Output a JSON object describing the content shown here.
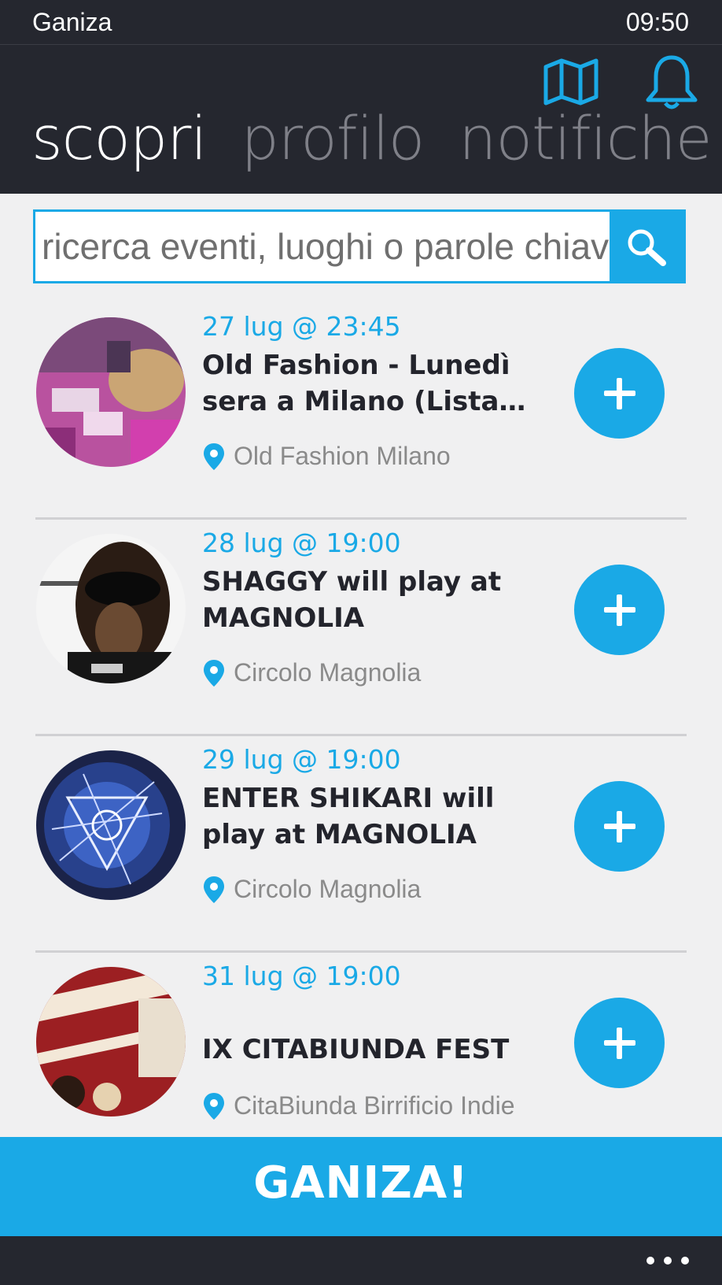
{
  "status_bar": {
    "app_name": "Ganiza",
    "time": "09:50"
  },
  "header": {
    "icons": [
      "map-icon",
      "bell-icon"
    ],
    "tabs": [
      {
        "label": "scopri",
        "active": true
      },
      {
        "label": "profilo",
        "active": false
      },
      {
        "label": "notifiche",
        "active": false
      }
    ]
  },
  "search": {
    "placeholder": "ricerca eventi, luoghi o parole chiave",
    "value": ""
  },
  "events": [
    {
      "date": "27 lug @ 23:45",
      "title": "Old Fashion - Lunedì sera a Milano (Lista…",
      "venue": "Old Fashion Milano"
    },
    {
      "date": "28 lug @ 19:00",
      "title": "SHAGGY will play at MAGNOLIA",
      "venue": "Circolo Magnolia"
    },
    {
      "date": "29 lug @ 19:00",
      "title": "ENTER SHIKARI will play at MAGNOLIA",
      "venue": "Circolo Magnolia"
    },
    {
      "date": "31 lug @ 19:00",
      "title": "IX CITABIUNDA FEST",
      "venue": "CitaBiunda Birrificio Indie"
    }
  ],
  "cta": {
    "label": "GANIZA!"
  },
  "colors": {
    "accent": "#1aa9e6",
    "bar": "#25272f",
    "background": "#f0f0f1"
  }
}
